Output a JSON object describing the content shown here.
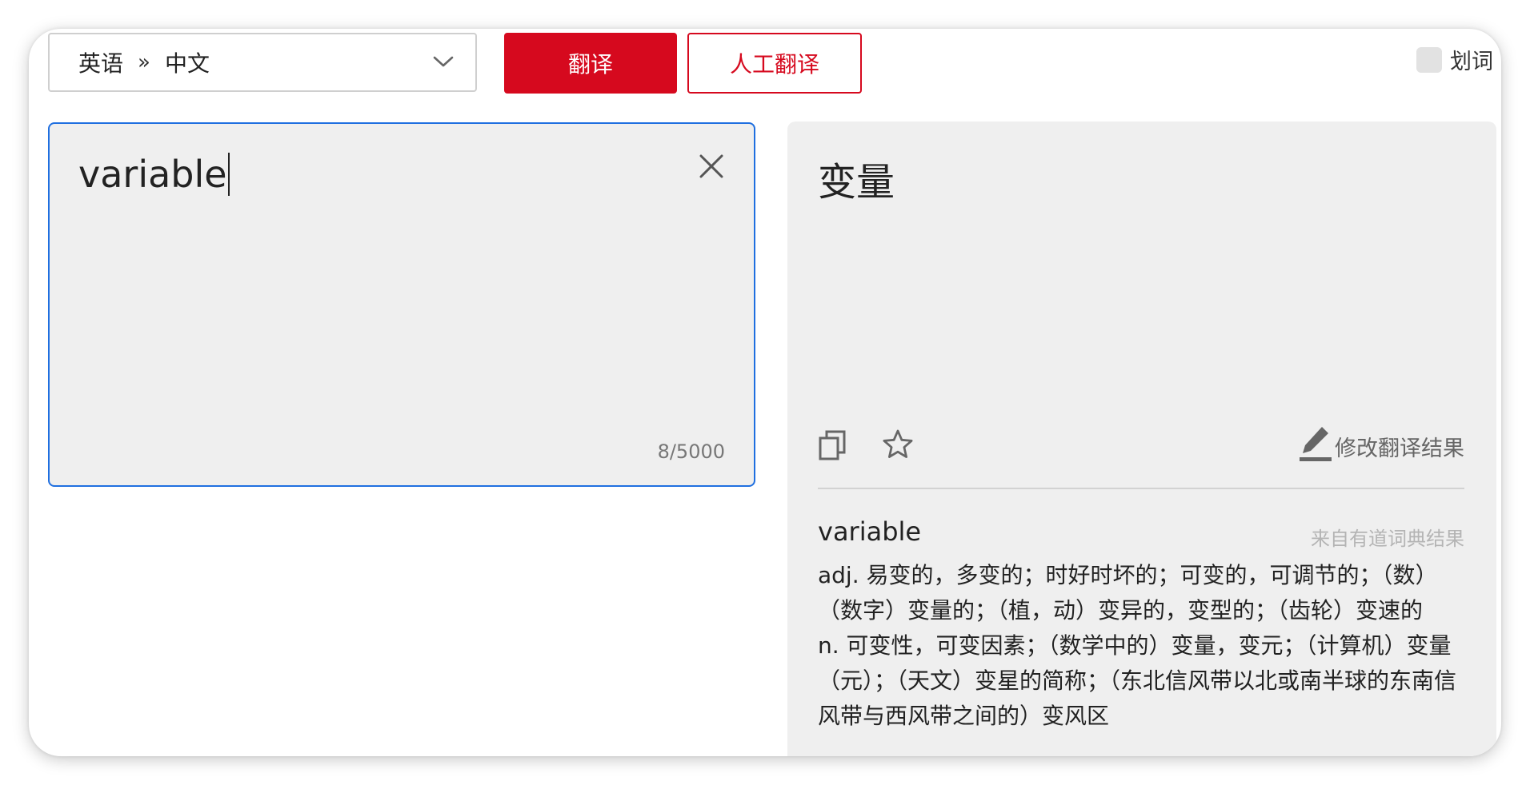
{
  "toolbar": {
    "source_lang": "英语",
    "separator": "»",
    "target_lang": "中文",
    "translate_label": "翻译",
    "human_translate_label": "人工翻译",
    "huaci_label": "划词"
  },
  "input": {
    "text": "variable",
    "char_count": "8/5000"
  },
  "output": {
    "text": "变量",
    "edit_label": "修改翻译结果"
  },
  "dictionary": {
    "word": "variable",
    "source": "来自有道词典结果",
    "definitions": [
      "adj. 易变的，多变的；时好时坏的；可变的，可调节的；（数）（数字）变量的；（植，动）变异的，变型的；（齿轮）变速的",
      "n. 可变性，可变因素；（数学中的）变量，变元；（计算机）变量（元）；（天文）变星的简称；（东北信风带以北或南半球的东南信风带与西风带之间的）变风区"
    ]
  },
  "colors": {
    "brand_red": "#d6091e",
    "focus_blue": "#1f6fe0",
    "panel_bg": "#efefef"
  },
  "icons": [
    "chevron-down-icon",
    "close-icon",
    "copy-icon",
    "star-icon",
    "pencil-icon"
  ]
}
